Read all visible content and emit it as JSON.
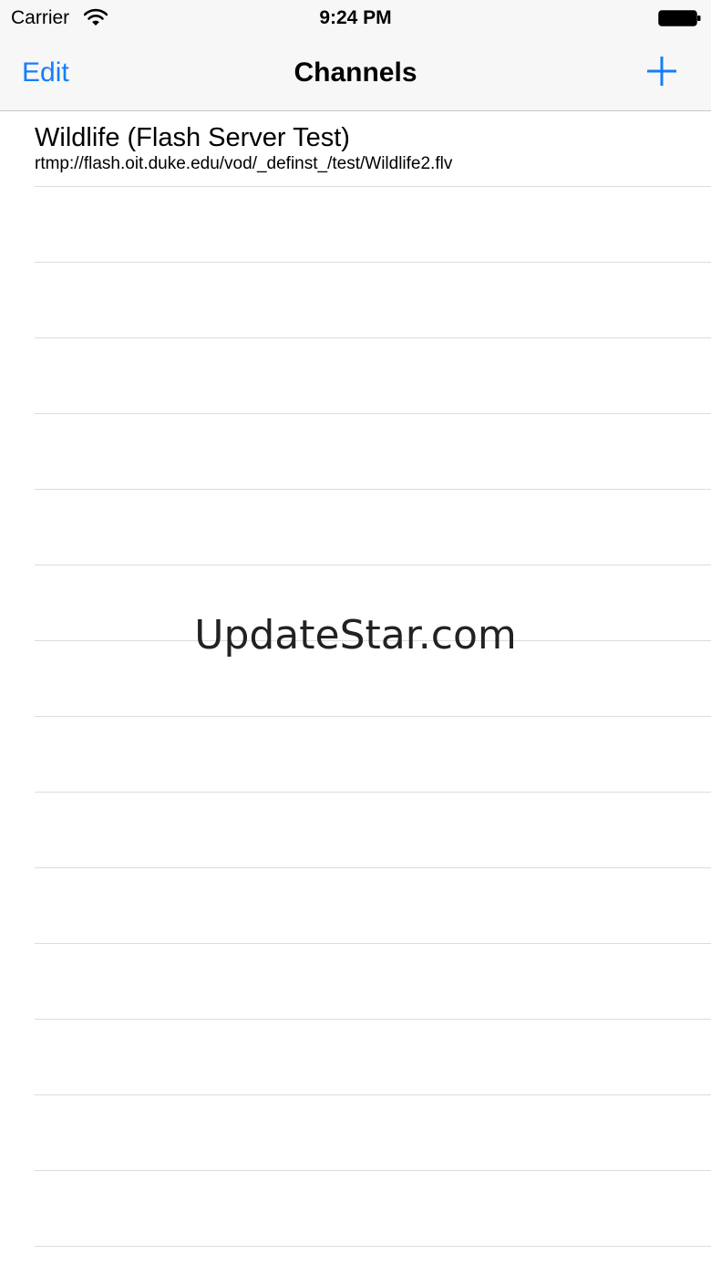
{
  "status_bar": {
    "carrier": "Carrier",
    "time": "9:24 PM",
    "wifi_icon": "wifi-icon",
    "battery_icon": "battery-icon"
  },
  "nav_bar": {
    "edit_label": "Edit",
    "title": "Channels",
    "add_icon": "plus-icon",
    "accent_color": "#147efb"
  },
  "channels": [
    {
      "title": "Wildlife (Flash Server Test)",
      "url": "rtmp://flash.oit.duke.edu/vod/_definst_/test/Wildlife2.flv"
    }
  ],
  "watermark": "UpdateStar.com"
}
